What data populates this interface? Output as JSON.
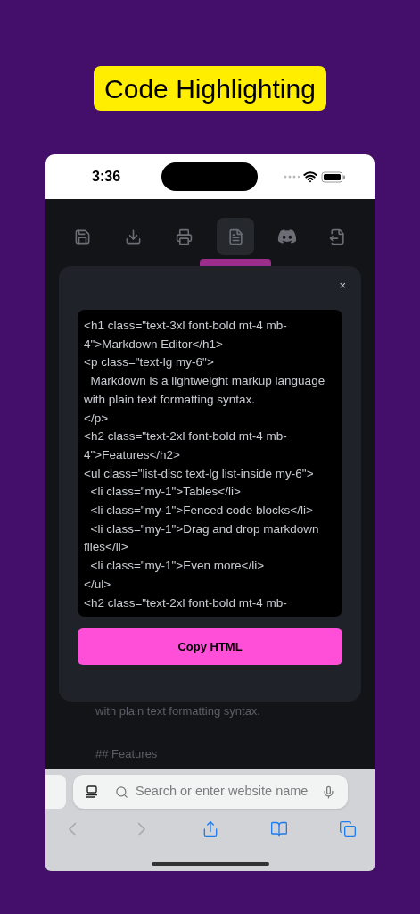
{
  "title_badge": "Code Highlighting",
  "status_bar": {
    "time": "3:36"
  },
  "toolbar": [
    {
      "kind": "save",
      "selected": false
    },
    {
      "kind": "download",
      "selected": false
    },
    {
      "kind": "print",
      "selected": false
    },
    {
      "kind": "html",
      "selected": true
    },
    {
      "kind": "discord",
      "selected": false
    },
    {
      "kind": "export",
      "selected": false
    }
  ],
  "modal": {
    "close": "×",
    "code_lines": [
      "<h1 class=\"text-3xl font-bold mt-4 mb-",
      "4\">Markdown Editor</h1>",
      "<p class=\"text-lg my-6\">",
      "  Markdown is a lightweight markup language",
      "with plain text formatting syntax.",
      "</p>",
      "<h2 class=\"text-2xl font-bold mt-4 mb-",
      "4\">Features</h2>",
      "<ul class=\"list-disc text-lg list-inside my-6\">",
      "  <li class=\"my-1\">Tables</li>",
      "  <li class=\"my-1\">Fenced code blocks</li>",
      "  <li class=\"my-1\">Drag and drop markdown",
      "files</li>",
      "  <li class=\"my-1\">Even more</li>",
      "</ul>",
      "<h2 class=\"text-2xl font-bold mt-4 mb-"
    ],
    "button": "Copy HTML"
  },
  "editor_lines": [
    "with plain text formatting syntax.",
    "## Features"
  ],
  "browser": {
    "placeholder": "Search or enter website name",
    "nav": [
      {
        "kind": "back",
        "disabled": true
      },
      {
        "kind": "forward",
        "disabled": true
      },
      {
        "kind": "share",
        "disabled": false
      },
      {
        "kind": "bookmarks",
        "disabled": false
      },
      {
        "kind": "tabs",
        "disabled": false
      }
    ]
  }
}
